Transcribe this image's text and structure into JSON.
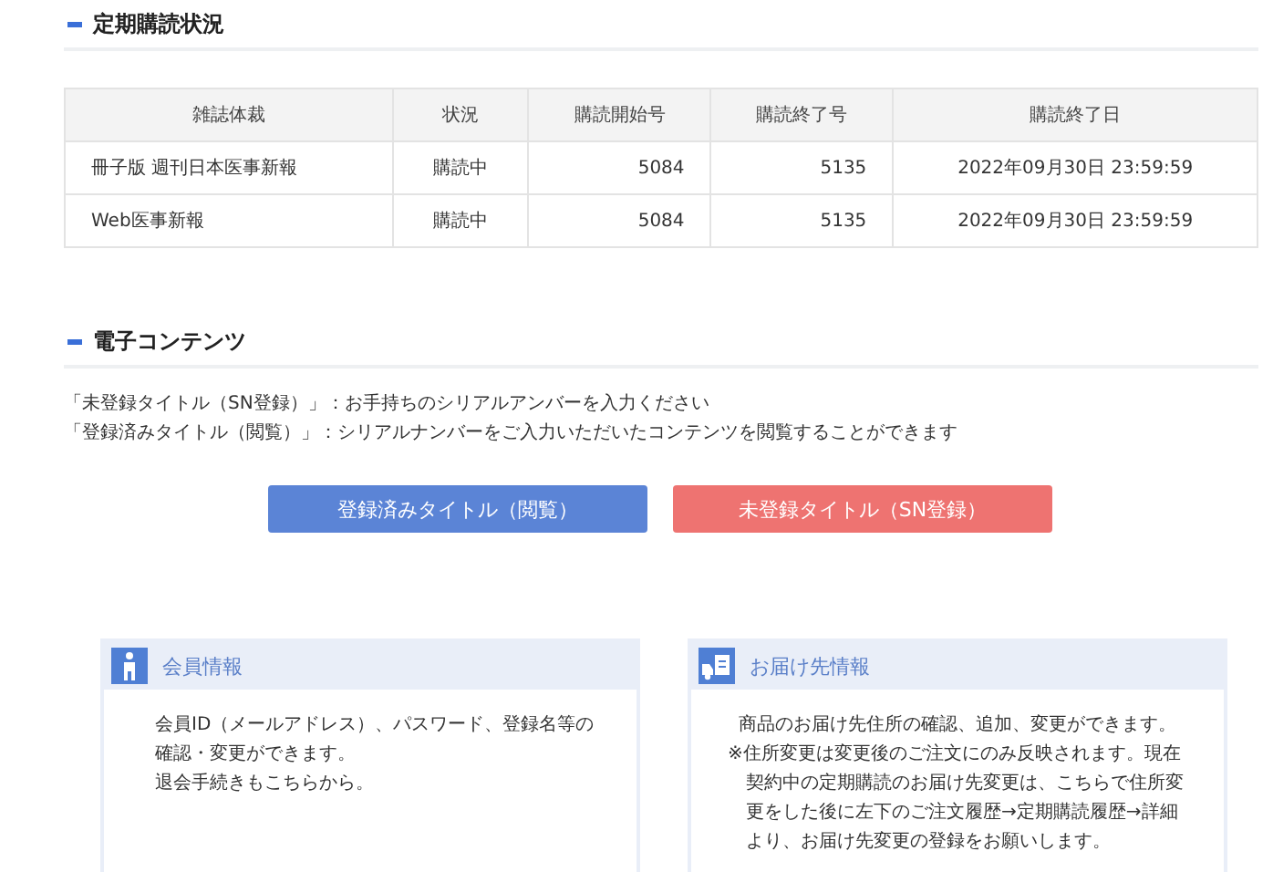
{
  "subscription_section": {
    "title": "定期購読状況",
    "table": {
      "columns": [
        "雑誌体裁",
        "状況",
        "購読開始号",
        "購読終了号",
        "購読終了日"
      ],
      "rows": [
        [
          "冊子版 週刊日本医事新報",
          "購読中",
          "5084",
          "5135",
          "2022年09月30日 23:59:59"
        ],
        [
          "Web医事新報",
          "購読中",
          "5084",
          "5135",
          "2022年09月30日 23:59:59"
        ]
      ]
    }
  },
  "digital_section": {
    "title": "電子コンテンツ",
    "notes": [
      "「未登録タイトル（SN登録）」：お手持ちのシリアルアンバーを入力ください",
      "「登録済みタイトル（閲覧）」：シリアルナンバーをご入力いただいたコンテンツを閲覧することができます"
    ],
    "buttons": [
      {
        "label": "登録済みタイトル（閲覧）",
        "color": "#5b84d6"
      },
      {
        "label": "未登録タイトル（SN登録）",
        "color": "#ee7371"
      }
    ]
  },
  "cards": [
    {
      "kind": "member",
      "title": "会員情報",
      "paragraphs": [
        {
          "text": "会員ID（メールアドレス）、パスワード、登録名等の確認・変更ができます。",
          "kind": "plain"
        },
        {
          "text": "退会手続きもこちらから。",
          "kind": "plain"
        }
      ]
    },
    {
      "kind": "delivery",
      "title": "お届け先情報",
      "paragraphs": [
        {
          "text": "商品のお届け先住所の確認、追加、変更ができます。",
          "kind": "plain"
        },
        {
          "text": "※住所変更は変更後のご注文にのみ反映されます。現在契約中の定期購読のお届け先変更は、こちらで住所変更をした後に左下のご注文履歴→定期購読履歴→詳細より、お届け先変更の登録をお願いします。",
          "kind": "note"
        }
      ]
    }
  ]
}
